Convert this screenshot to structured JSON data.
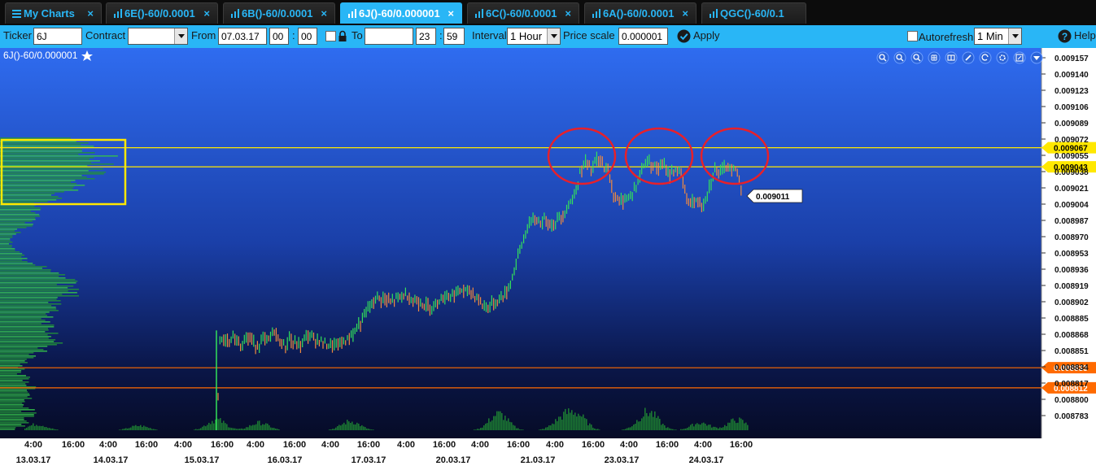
{
  "tabs": [
    {
      "label": "My Charts",
      "icon": "menu-icon",
      "active": false
    },
    {
      "label": "6E()-60/0.0001",
      "icon": "bar-chart-icon",
      "active": false
    },
    {
      "label": "6B()-60/0.0001",
      "icon": "bar-chart-icon",
      "active": false
    },
    {
      "label": "6J()-60/0.000001",
      "icon": "bar-chart-icon",
      "active": true
    },
    {
      "label": "6C()-60/0.0001",
      "icon": "bar-chart-icon",
      "active": false
    },
    {
      "label": "6A()-60/0.0001",
      "icon": "bar-chart-icon",
      "active": false
    },
    {
      "label": "QGC()-60/0.1",
      "icon": "bar-chart-icon",
      "active": false
    }
  ],
  "toolbar": {
    "ticker_label": "Ticker",
    "ticker_value": "6J",
    "contract_label": "Contract",
    "contract_value": "",
    "from_label": "From",
    "from_date": "07.03.17",
    "from_hour": "00",
    "from_min": "00",
    "to_label": "To",
    "to_date": "",
    "to_hour": "23",
    "to_min": "59",
    "time_sep": ":",
    "interval_label": "Interval",
    "interval_value": "1 Hour",
    "price_scale_label": "Price scale",
    "price_scale_value": "0.000001",
    "apply_label": "Apply",
    "autorefresh_label": "Autorefresh",
    "autorefresh_value": "1 Min",
    "help_label": "Help"
  },
  "chart_data": {
    "type": "bar",
    "title": "6J()-60/0.000001",
    "last_price": "0.009011",
    "ylim": [
      0.00877,
      0.009165
    ],
    "y_ticks": [
      "0.009157",
      "0.009140",
      "0.009123",
      "0.009106",
      "0.009089",
      "0.009072",
      "0.009055",
      "0.009038",
      "0.009021",
      "0.009004",
      "0.008987",
      "0.008970",
      "0.008953",
      "0.008936",
      "0.008919",
      "0.008902",
      "0.008885",
      "0.008868",
      "0.008851",
      "0.008834",
      "0.008817",
      "0.008800",
      "0.008783"
    ],
    "level_labels": [
      {
        "value": 0.009063,
        "label": "0.009067",
        "color": "#ffe800"
      },
      {
        "value": 0.009043,
        "label": "0.009043",
        "color": "#ffe800"
      },
      {
        "value": 0.008833,
        "label": "0.008833",
        "color": "#ff6a00"
      },
      {
        "value": 0.008812,
        "label": "0.008812",
        "color": "#ff6a00"
      }
    ],
    "x_time_ticks": [
      "4:00",
      "16:00",
      "4:00",
      "16:00",
      "4:00",
      "16:00",
      "4:00",
      "16:00",
      "4:00",
      "16:00",
      "4:00",
      "16:00",
      "4:00",
      "16:00",
      "4:00",
      "16:00",
      "4:00",
      "16:00",
      "4:00",
      "16:00"
    ],
    "x_date_ticks": [
      "13.03.17",
      "14.03.17",
      "15.03.17",
      "16.03.17",
      "17.03.17",
      "20.03.17",
      "21.03.17",
      "23.03.17",
      "24.03.17"
    ],
    "price_path": [
      [
        0,
        0.008805
      ],
      [
        1,
        0.008858
      ],
      [
        3,
        0.008862
      ],
      [
        6,
        0.008858
      ],
      [
        9,
        0.008866
      ],
      [
        12,
        0.008857
      ],
      [
        15,
        0.008866
      ],
      [
        18,
        0.008861
      ],
      [
        21,
        0.008856
      ],
      [
        24,
        0.008862
      ],
      [
        27,
        0.008862
      ],
      [
        30,
        0.008871
      ],
      [
        33,
        0.00886
      ],
      [
        36,
        0.008856
      ],
      [
        38,
        0.008863
      ],
      [
        41,
        0.008858
      ],
      [
        44,
        0.008856
      ],
      [
        47,
        0.008867
      ],
      [
        50,
        0.008865
      ],
      [
        53,
        0.008862
      ],
      [
        57,
        0.008858
      ],
      [
        61,
        0.008856
      ],
      [
        65,
        0.008858
      ],
      [
        69,
        0.008862
      ],
      [
        73,
        0.008872
      ],
      [
        77,
        0.008882
      ],
      [
        80,
        0.008895
      ],
      [
        84,
        0.008904
      ],
      [
        88,
        0.008906
      ],
      [
        92,
        0.008901
      ],
      [
        96,
        0.008906
      ],
      [
        100,
        0.00891
      ],
      [
        104,
        0.008903
      ],
      [
        108,
        0.008902
      ],
      [
        111,
        0.008897
      ],
      [
        114,
        0.008897
      ],
      [
        118,
        0.008905
      ],
      [
        122,
        0.008908
      ],
      [
        126,
        0.00891
      ],
      [
        130,
        0.008914
      ],
      [
        134,
        0.008912
      ],
      [
        138,
        0.008907
      ],
      [
        141,
        0.008898
      ],
      [
        144,
        0.008897
      ],
      [
        148,
        0.008901
      ],
      [
        151,
        0.008906
      ],
      [
        154,
        0.008912
      ],
      [
        157,
        0.008928
      ],
      [
        160,
        0.00895
      ],
      [
        163,
        0.008968
      ],
      [
        166,
        0.008983
      ],
      [
        169,
        0.008988
      ],
      [
        172,
        0.008985
      ],
      [
        175,
        0.008988
      ],
      [
        178,
        0.008982
      ],
      [
        181,
        0.008988
      ],
      [
        184,
        0.008993
      ],
      [
        187,
        0.009003
      ],
      [
        190,
        0.009013
      ],
      [
        193,
        0.009035
      ],
      [
        196,
        0.009048
      ],
      [
        199,
        0.00904
      ],
      [
        202,
        0.00905
      ],
      [
        205,
        0.009046
      ],
      [
        208,
        0.009038
      ],
      [
        211,
        0.009015
      ],
      [
        214,
        0.009005
      ],
      [
        217,
        0.00901
      ],
      [
        220,
        0.009013
      ],
      [
        223,
        0.009022
      ],
      [
        226,
        0.00904
      ],
      [
        229,
        0.00905
      ],
      [
        232,
        0.009045
      ],
      [
        235,
        0.009042
      ],
      [
        238,
        0.009043
      ],
      [
        241,
        0.009035
      ],
      [
        244,
        0.00904
      ],
      [
        247,
        0.009037
      ],
      [
        250,
        0.009008
      ],
      [
        253,
        0.009006
      ],
      [
        256,
        0.009006
      ],
      [
        259,
        0.009004
      ],
      [
        262,
        0.009022
      ],
      [
        265,
        0.00904
      ],
      [
        268,
        0.009036
      ],
      [
        271,
        0.009042
      ],
      [
        274,
        0.009042
      ],
      [
        277,
        0.009038
      ],
      [
        280,
        0.009011
      ]
    ],
    "colors": {
      "up": "#33e15a",
      "down": "#f28a3e",
      "level_yellow": "#ffe800",
      "level_orange": "#ff6a00",
      "circle": "#e8202a",
      "box": "#ffe800"
    }
  }
}
